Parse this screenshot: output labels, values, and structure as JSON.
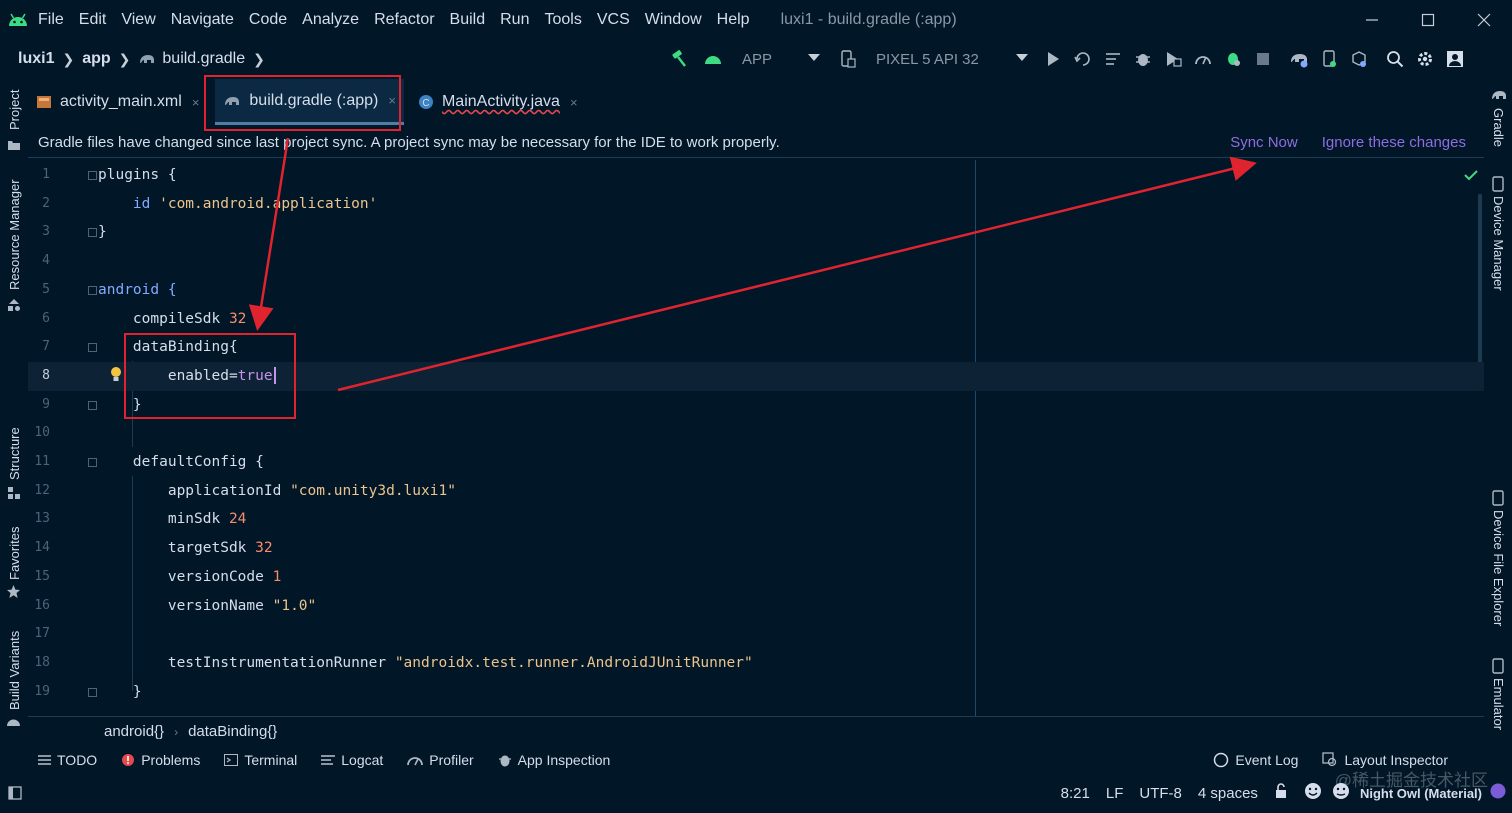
{
  "menubar": {
    "items": [
      "File",
      "Edit",
      "View",
      "Navigate",
      "Code",
      "Analyze",
      "Refactor",
      "Build",
      "Run",
      "Tools",
      "VCS",
      "Window",
      "Help"
    ],
    "window_title": "luxi1 - build.gradle (:app)"
  },
  "nav": {
    "project": "luxi1",
    "module": "app",
    "file": "build.gradle"
  },
  "toolbar": {
    "run_config": "APP",
    "device": "PIXEL 5 API 32"
  },
  "left_strip": [
    "Project",
    "Resource Manager",
    "Structure",
    "Favorites",
    "Build Variants"
  ],
  "right_strip": [
    "Gradle",
    "Device Manager",
    "Device File Explorer",
    "Emulator"
  ],
  "tabs": [
    {
      "label": "activity_main.xml",
      "close": "×"
    },
    {
      "label": "build.gradle (:app)",
      "close": "×"
    },
    {
      "label": "MainActivity.java",
      "close": "×"
    }
  ],
  "banner": {
    "message": "Gradle files have changed since last project sync. A project sync may be necessary for the IDE to work properly.",
    "sync_now": "Sync Now",
    "ignore": "Ignore these changes"
  },
  "editor": {
    "line_numbers": [
      "1",
      "2",
      "3",
      "4",
      "5",
      "6",
      "7",
      "8",
      "9",
      "10",
      "11",
      "12",
      "13",
      "14",
      "15",
      "16",
      "17",
      "18",
      "19"
    ],
    "lines": {
      "l1": "plugins {",
      "l2_a": "    id ",
      "l2_b": "'com.android.application'",
      "l3": "}",
      "l5": "android {",
      "l6_a": "    compileSdk ",
      "l6_b": "32",
      "l7": "    dataBinding{",
      "l8_a": "        enabled=",
      "l8_b": "true",
      "l9": "    }",
      "l11": "    defaultConfig {",
      "l12_a": "        applicationId ",
      "l12_b": "\"com.unity3d.luxi1\"",
      "l13_a": "        minSdk ",
      "l13_b": "24",
      "l14_a": "        targetSdk ",
      "l14_b": "32",
      "l15_a": "        versionCode ",
      "l15_b": "1",
      "l16_a": "        versionName ",
      "l16_b": "\"1.0\"",
      "l18_a": "        testInstrumentationRunner ",
      "l18_b": "\"androidx.test.runner.AndroidJUnitRunner\"",
      "l19": "    }"
    }
  },
  "code_breadcrumb": [
    "android{}",
    "dataBinding{}"
  ],
  "tool_windows": [
    "TODO",
    "Problems",
    "Terminal",
    "Logcat",
    "Profiler",
    "App Inspection"
  ],
  "tool_windows_right": [
    "Event Log",
    "Layout Inspector"
  ],
  "status": {
    "position": "8:21",
    "line_sep": "LF",
    "encoding": "UTF-8",
    "indent": "4 spaces",
    "theme": "Night Owl (Material)"
  },
  "watermark": "@稀土掘金技术社区",
  "colors": {
    "background": "#011627",
    "link": "#8c6ee0",
    "annotation": "#e0242f",
    "string": "#ecc48d",
    "number": "#f78c6c"
  }
}
